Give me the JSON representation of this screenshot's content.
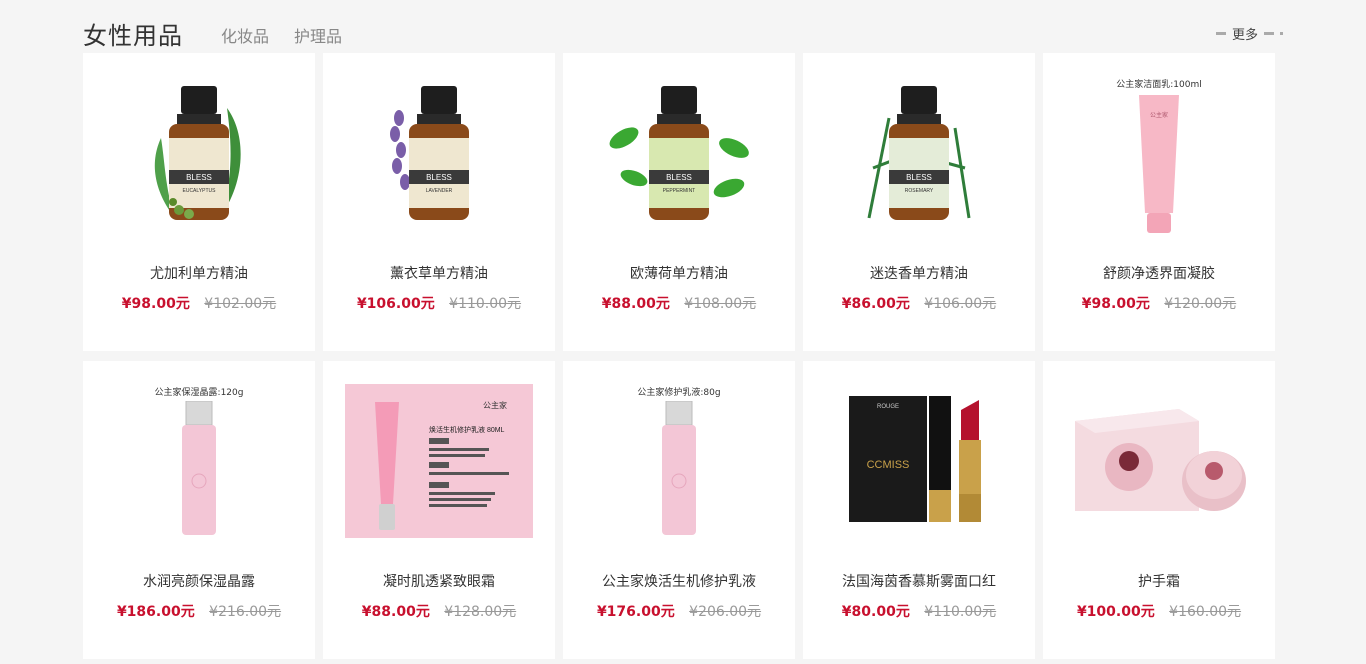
{
  "header": {
    "title": "女性用品",
    "tabs": [
      "化妆品",
      "护理品"
    ],
    "more_label": "更多"
  },
  "products": [
    {
      "name": "尤加利单方精油",
      "price": "¥98.00元",
      "old_price": "¥102.00元",
      "image": "eucalyptus-oil-bottle",
      "brand_text": "BLESS",
      "label_text": "EUCALYPTUS",
      "leaf_color": "#3e8f3a"
    },
    {
      "name": "薰衣草单方精油",
      "price": "¥106.00元",
      "old_price": "¥110.00元",
      "image": "lavender-oil-bottle",
      "brand_text": "BLESS",
      "label_text": "LAVENDER",
      "leaf_color": "#7a5ea8"
    },
    {
      "name": "欧薄荷单方精油",
      "price": "¥88.00元",
      "old_price": "¥108.00元",
      "image": "peppermint-oil-bottle",
      "brand_text": "BLESS",
      "label_text": "PEPPERMINT",
      "leaf_color": "#3aa832"
    },
    {
      "name": "迷迭香单方精油",
      "price": "¥86.00元",
      "old_price": "¥106.00元",
      "image": "rosemary-oil-bottle",
      "brand_text": "BLESS",
      "label_text": "ROSEMARY",
      "leaf_color": "#2f7d3a"
    },
    {
      "name": "舒颜净透界面凝胶",
      "price": "¥98.00元",
      "old_price": "¥120.00元",
      "image": "cleanser-tube",
      "caption": "公主家洁面乳:100ml"
    },
    {
      "name": "水润亮颜保湿晶露",
      "price": "¥186.00元",
      "old_price": "¥216.00元",
      "image": "moisturizing-bottle",
      "caption": "公主家保湿晶露:120g"
    },
    {
      "name": "凝时肌透紧致眼霜",
      "price": "¥88.00元",
      "old_price": "¥128.00元",
      "image": "eye-cream-box",
      "box_title": "焕活生机修护乳液 80ML",
      "brand_text": "公主家"
    },
    {
      "name": "公主家焕活生机修护乳液",
      "price": "¥176.00元",
      "old_price": "¥206.00元",
      "image": "lotion-bottle",
      "caption": "公主家修护乳液:80g"
    },
    {
      "name": "法国海茵香慕斯雾面口红",
      "price": "¥80.00元",
      "old_price": "¥110.00元",
      "image": "lipstick",
      "brand_text": "CCMISS",
      "box_text": "ROUGE"
    },
    {
      "name": "护手霜",
      "price": "¥100.00元",
      "old_price": "¥160.00元",
      "image": "hand-cream-box"
    }
  ],
  "colors": {
    "price": "#c8102e",
    "old_price": "#999999",
    "background": "#f5f5f5"
  }
}
